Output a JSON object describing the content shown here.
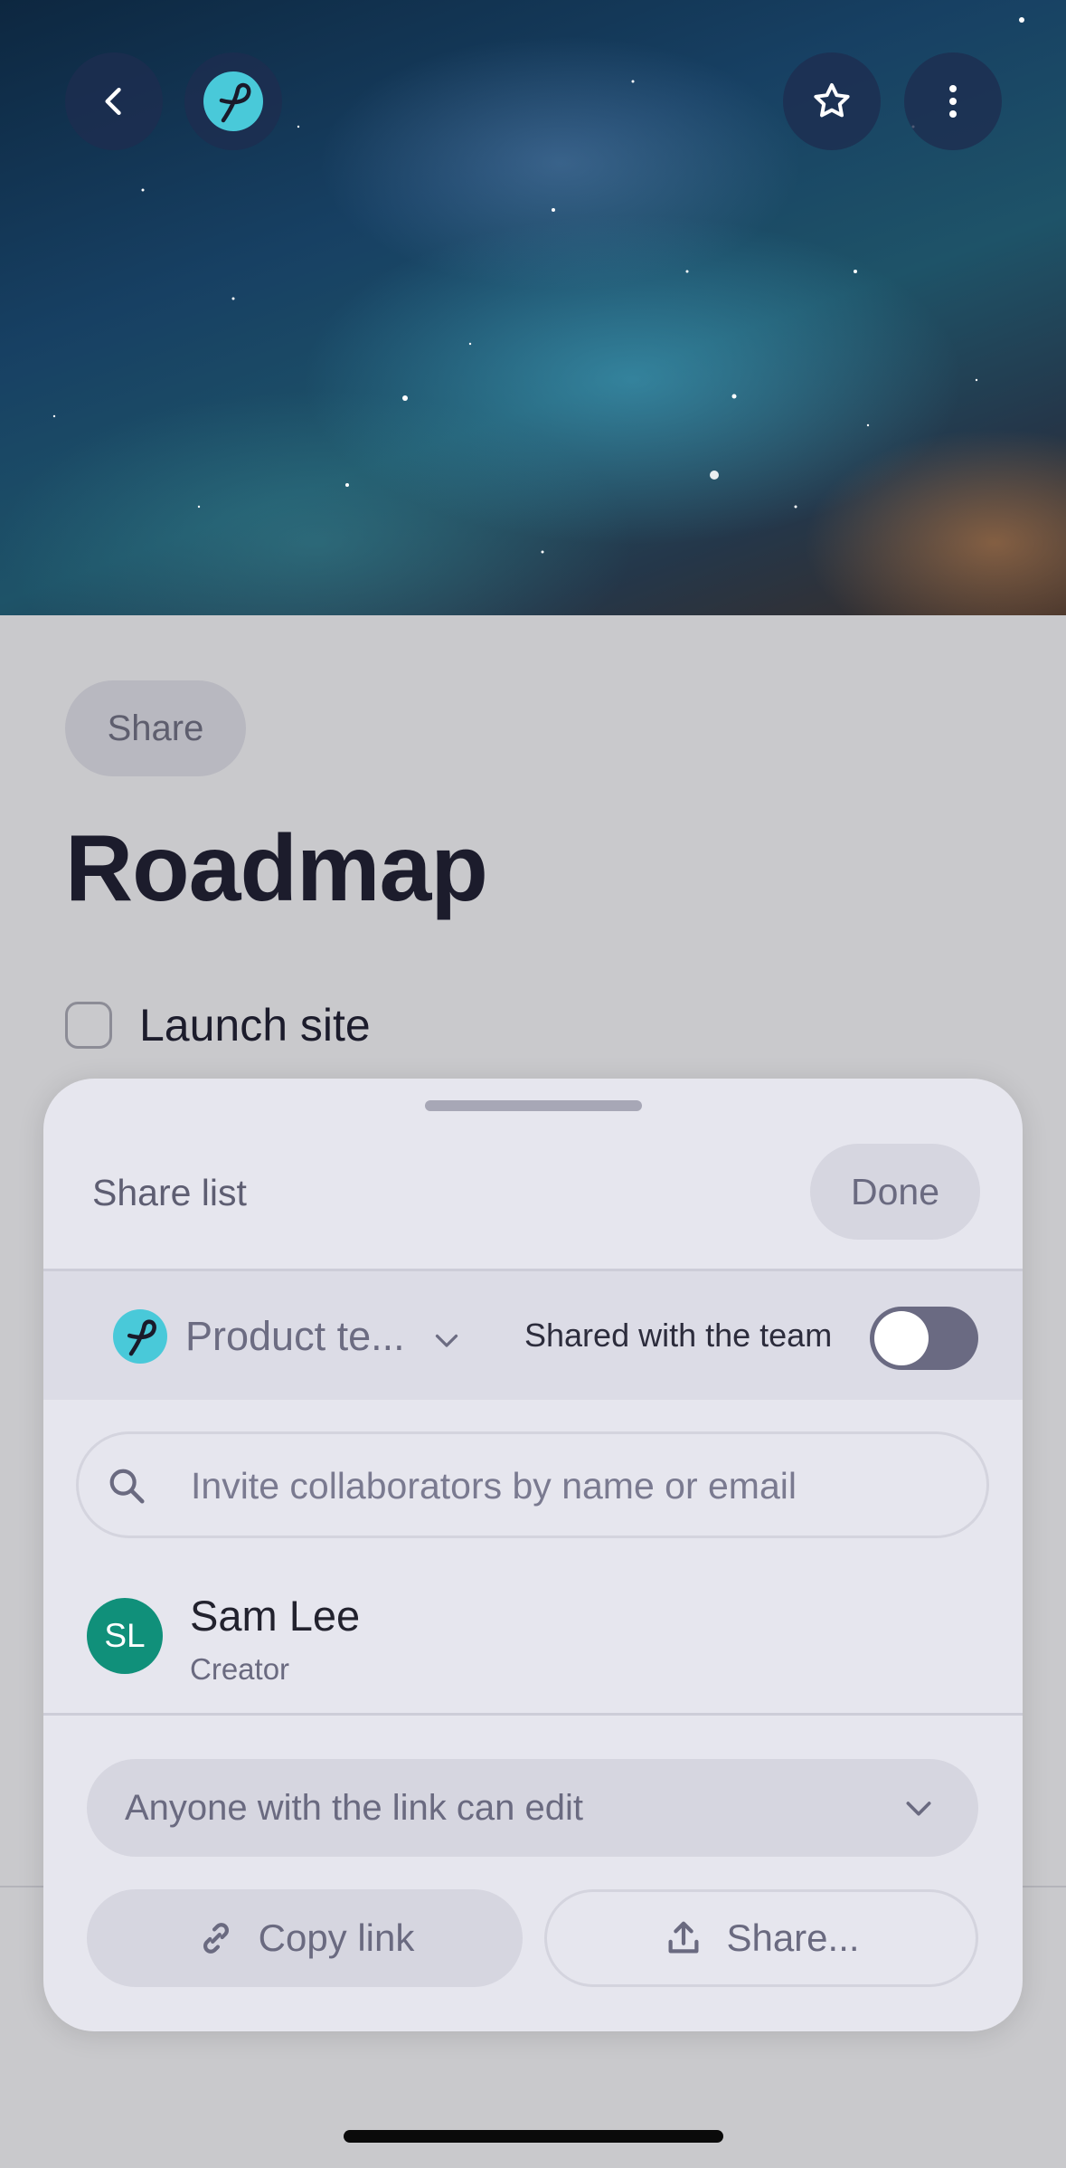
{
  "header": {
    "back_icon": "chevron-left-icon",
    "logo_icon": "app-logo-icon",
    "star_icon": "star-icon",
    "more_icon": "more-vertical-icon"
  },
  "doc": {
    "share_chip": "Share",
    "title": "Roadmap",
    "tasks": [
      {
        "label": "Launch site",
        "checked": false
      }
    ]
  },
  "sheet": {
    "title": "Share list",
    "done_label": "Done",
    "team": {
      "name": "Product te...",
      "shared_label": "Shared with the team",
      "shared_enabled": false
    },
    "search": {
      "placeholder": "Invite collaborators by name or email"
    },
    "collaborators": [
      {
        "initials": "SL",
        "name": "Sam Lee",
        "role": "Creator",
        "avatar_color": "#10907a"
      }
    ],
    "permission": "Anyone with the link can edit",
    "copy_link_label": "Copy link",
    "share_label": "Share..."
  },
  "colors": {
    "accent_teal": "#49c9d9",
    "avatar_green": "#10907a",
    "sheet_bg": "#e6e6ee"
  }
}
